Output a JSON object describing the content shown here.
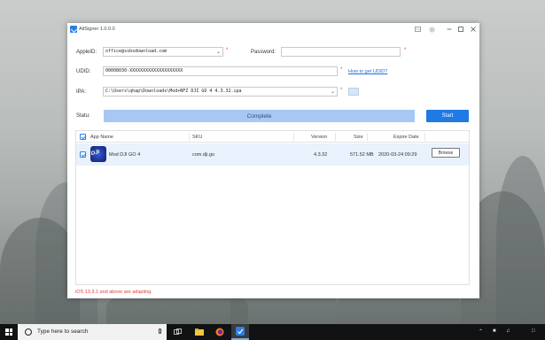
{
  "window": {
    "title": "AltSigner 1.0.0.0"
  },
  "form": {
    "appleid_label": "AppleID:",
    "appleid_value": "office@ssbsdownload.com",
    "password_label": "Password:",
    "password_value": "",
    "required_mark": "*",
    "udid_label": "UDID:",
    "udid_value": "00008030-XXXXXXXXXXXXXXXXXXXX",
    "udid_link": "How to get UDID?",
    "ipa_label": "IPA:",
    "ipa_value": "C:\\Users\\qhap\\Downloads\\Mod+NFZ DJI GO 4 4.3.32.ipa",
    "status_label": "Statu:",
    "status_value": "Complete",
    "start_label": "Start"
  },
  "table": {
    "columns": [
      "App Name",
      "SKU",
      "Version",
      "Size",
      "Expire Date"
    ],
    "rows": [
      {
        "checked": true,
        "icon_text": "DJI",
        "name": "Mod DJI GO 4",
        "sku": "com.dji.go",
        "version": "4.3.32",
        "size": "571.52 MB",
        "expire": "2020-03-24 09:29",
        "action": "Browse"
      }
    ]
  },
  "footer_note": "iOS 13.3.1 and above are adapting.",
  "taskbar": {
    "search_placeholder": "Type here to search"
  },
  "colors": {
    "accent": "#1f7ae6",
    "progress": "#a7c8f3",
    "row_selected": "#e9f1fc",
    "warning": "#e53b3b"
  },
  "progress_fraction": 1.0
}
